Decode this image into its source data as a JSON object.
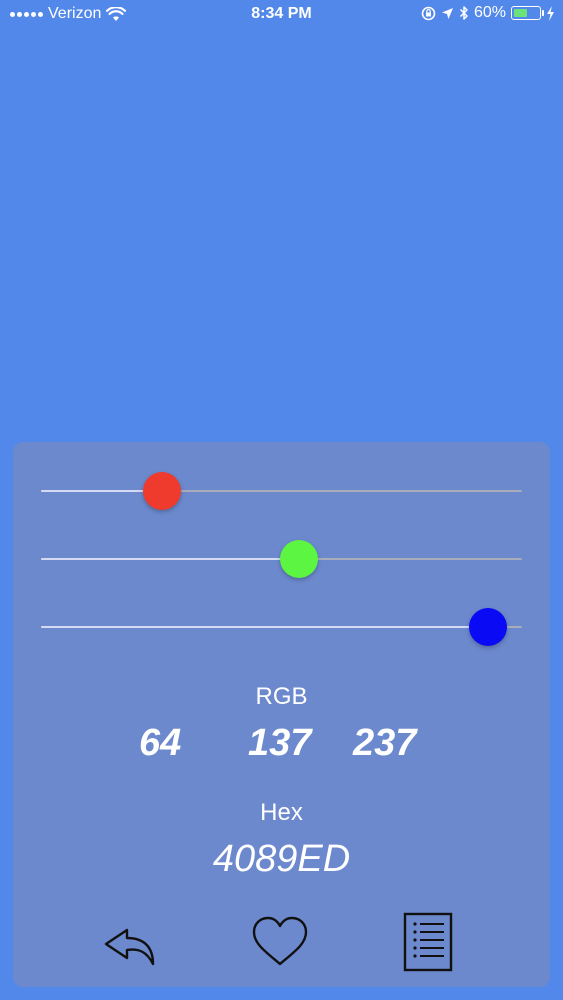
{
  "status_bar": {
    "carrier": "Verizon",
    "time": "8:34 PM",
    "battery_percent": "60%",
    "battery_level": 0.6,
    "icons": [
      "wifi-icon",
      "screen-lock-icon",
      "location-icon",
      "bluetooth-icon",
      "battery-icon",
      "charging-icon"
    ]
  },
  "background_color": "#4089ED",
  "sliders": [
    {
      "name": "red",
      "value": 64,
      "max": 255,
      "color": "#EF3A2E"
    },
    {
      "name": "green",
      "value": 137,
      "max": 255,
      "color": "#5CF542"
    },
    {
      "name": "blue",
      "value": 237,
      "max": 255,
      "color": "#0A0AF4"
    }
  ],
  "rgb": {
    "label": "RGB",
    "r": "64",
    "g": "137",
    "b": "237"
  },
  "hex": {
    "label": "Hex",
    "value": "4089ED"
  },
  "toolbar": {
    "icons": [
      "share-icon",
      "heart-icon",
      "list-icon"
    ]
  }
}
